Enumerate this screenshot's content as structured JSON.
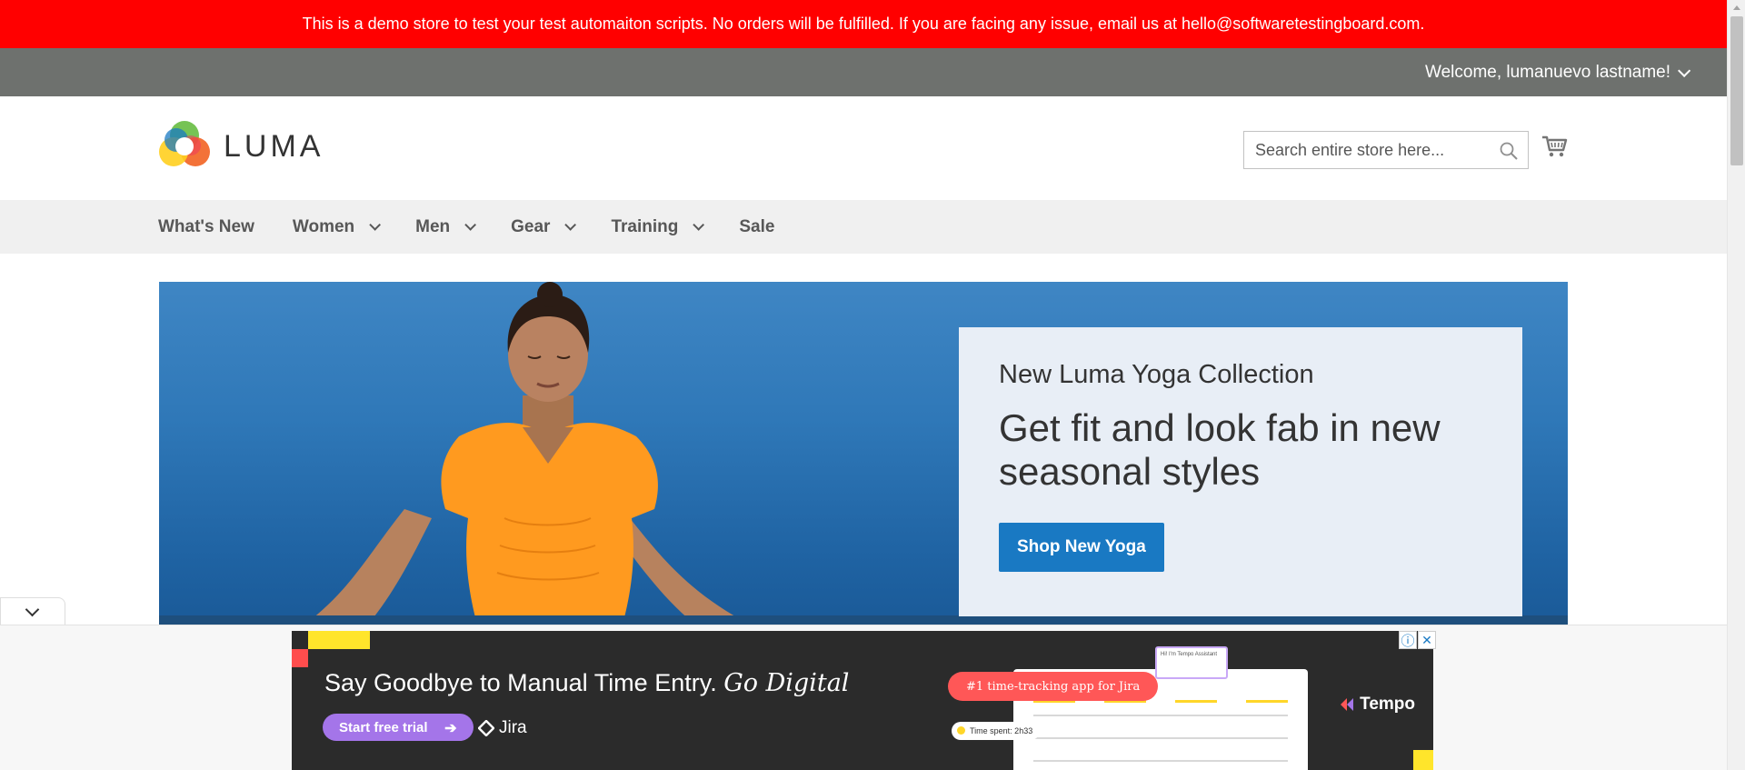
{
  "notice": {
    "text": "This is a demo store to test your test automaiton scripts. No orders will be fulfilled. If you are facing any issue, email us at hello@softwaretestingboard.com."
  },
  "header": {
    "welcome": "Welcome, lumanuevo lastname!",
    "logo_text": "LUMA",
    "search_placeholder": "Search entire store here..."
  },
  "nav": {
    "items": [
      {
        "label": "What's New",
        "dropdown": false
      },
      {
        "label": "Women",
        "dropdown": true
      },
      {
        "label": "Men",
        "dropdown": true
      },
      {
        "label": "Gear",
        "dropdown": true
      },
      {
        "label": "Training",
        "dropdown": true
      },
      {
        "label": "Sale",
        "dropdown": false
      }
    ]
  },
  "hero": {
    "subtitle": "New Luma Yoga Collection",
    "title": "Get fit and look fab in new seasonal styles",
    "button": "Shop New Yoga"
  },
  "ad": {
    "headline": "Say Goodbye to Manual Time Entry.",
    "headline_em": "Go Digital",
    "cta": "Start free trial",
    "cta_arrow": "➔",
    "partner": "Jira",
    "pill": "#1 time-tracking app for Jira",
    "timer": "Time spent: 2h33",
    "popup": "Hi! I'm Tempo Assistant",
    "brand": "Tempo",
    "info_icon": "ⓘ",
    "close_icon": "✕"
  },
  "colors": {
    "notice_bg": "#ff0000",
    "header_bar": "#6e716e",
    "nav_bg": "#f0f0f0",
    "primary_button": "#1979c3",
    "hero_card": "#e8eef6",
    "ad_bg": "#2b2b2b",
    "ad_cta": "#a475e9"
  },
  "icons": {
    "welcome_toggle": "chevron-down-icon",
    "search": "magnifier-icon",
    "cart": "shopping-cart-icon",
    "ad_collapse": "chevron-down-icon"
  }
}
